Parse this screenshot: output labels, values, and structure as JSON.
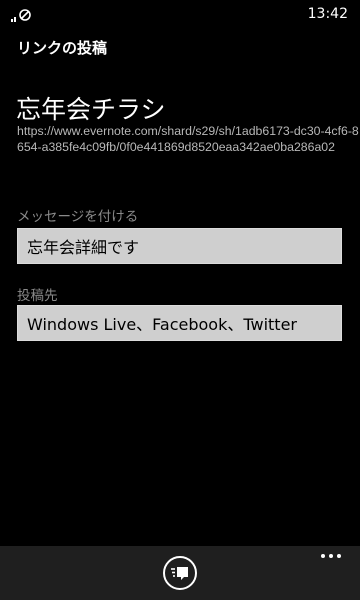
{
  "status_bar": {
    "time": "13:42",
    "signal_icon": "signal-off-icon"
  },
  "page": {
    "title": "リンクの投稿"
  },
  "link": {
    "title": "忘年会チラシ",
    "url": "https://www.evernote.com/shard/s29/sh/1adb6173-dc30-4cf6-8654-a385fe4c09fb/0f0e441869d8520eaa342ae0ba286a02"
  },
  "message": {
    "label": "メッセージを付ける",
    "value": "忘年会詳細です"
  },
  "target": {
    "label": "投稿先",
    "value": "Windows Live、Facebook、Twitter"
  },
  "app_bar": {
    "post_icon": "post-message-icon",
    "more_icon": "more-dots-icon"
  },
  "colors": {
    "background": "#000000",
    "app_bar": "#1f1f1f",
    "textbox": "#cfcfcf",
    "label": "#8a8a8a"
  }
}
